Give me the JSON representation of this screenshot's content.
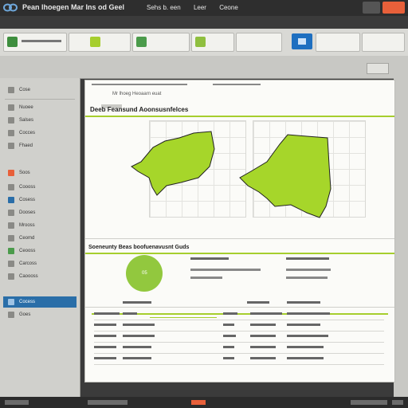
{
  "window": {
    "title": "Pean lhoegen Mar Ins od Geel",
    "menu": [
      "Sehs b. een",
      "Leer",
      "Ceone"
    ]
  },
  "sidebar": {
    "items": [
      {
        "label": "Cose"
      },
      {
        "label": "Nuoee"
      },
      {
        "label": "Salses"
      },
      {
        "label": "Cocces"
      },
      {
        "label": "Fhaed"
      },
      {
        "label": "Soos"
      },
      {
        "label": "Coooss"
      },
      {
        "label": "Cosess"
      },
      {
        "label": "Dooses"
      },
      {
        "label": "Mrooss"
      },
      {
        "label": "Ceomd"
      },
      {
        "label": "Ceooss"
      },
      {
        "label": "Carcoss"
      },
      {
        "label": "Caoooss"
      },
      {
        "label": "Cocess",
        "active": true
      },
      {
        "label": "Goes"
      }
    ]
  },
  "document": {
    "header": "Mr lhoeg Heoaarn euat",
    "section1_title": "Deeb Feansund Aoonsusnfelces",
    "section2_title": "Soeneunty Beas boofuenavusnt Guds",
    "donut_value": "05"
  },
  "colors": {
    "accent_green": "#92c83e",
    "accent_orange": "#e8603a",
    "primary_blue": "#1e6fc0"
  }
}
